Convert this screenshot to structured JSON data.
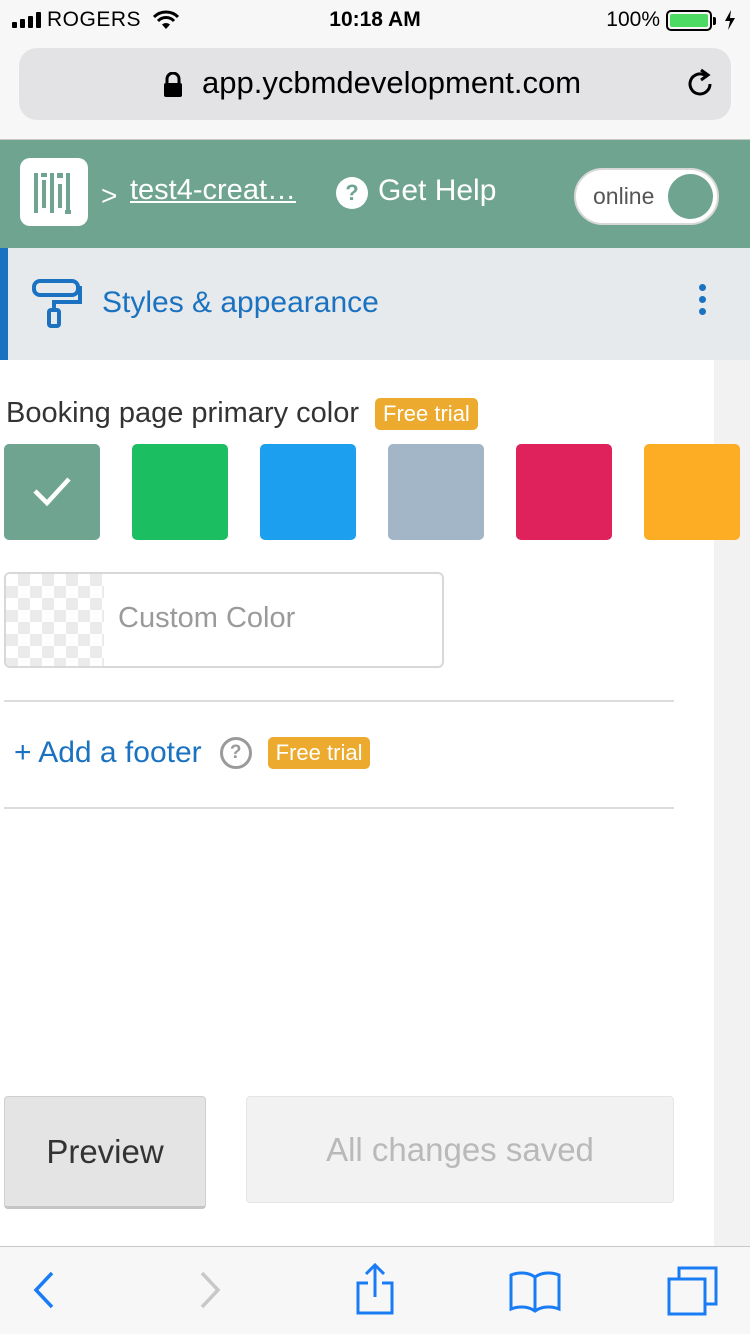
{
  "status_bar": {
    "carrier": "ROGERS",
    "time": "10:18 AM",
    "battery": "100%",
    "battery_level": 1.0
  },
  "browser": {
    "url": "app.ycbmdevelopment.com",
    "icons": [
      "lock-icon",
      "reload-icon"
    ]
  },
  "header": {
    "breadcrumb": "test4-creat…",
    "help_label": "Get Help",
    "toggle_label": "online",
    "brand_color": "#6fa491"
  },
  "section": {
    "title": "Styles & appearance",
    "icon": "paint-roller-icon",
    "accent_color": "#1a72c0"
  },
  "primary_color": {
    "label": "Booking page primary color",
    "badge": "Free trial",
    "swatches": [
      {
        "name": "swatch-green-gray",
        "color": "#6fa491",
        "selected": true
      },
      {
        "name": "swatch-green",
        "color": "#1bbf61",
        "selected": false
      },
      {
        "name": "swatch-blue",
        "color": "#1d9ff0",
        "selected": false
      },
      {
        "name": "swatch-gray-blue",
        "color": "#a3b6c7",
        "selected": false
      },
      {
        "name": "swatch-pink",
        "color": "#e0225c",
        "selected": false
      },
      {
        "name": "swatch-orange",
        "color": "#fdad24",
        "selected": false
      }
    ],
    "custom_placeholder": "Custom Color"
  },
  "footer": {
    "add_label": "+ Add a footer",
    "badge": "Free trial",
    "help_glyph": "?"
  },
  "actions": {
    "preview_label": "Preview",
    "saved_label": "All changes saved"
  },
  "toolbar": {
    "icons": [
      "back-icon",
      "forward-icon",
      "share-icon",
      "bookmarks-icon",
      "tabs-icon"
    ]
  }
}
